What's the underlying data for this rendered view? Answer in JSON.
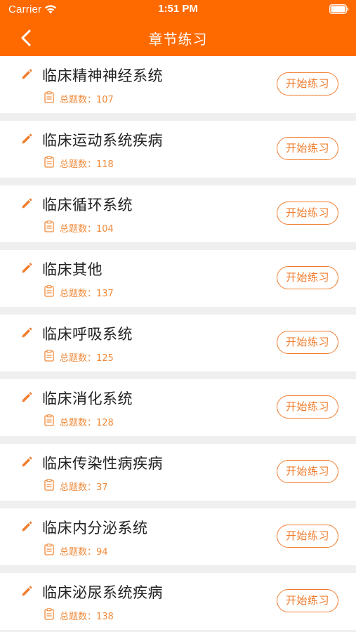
{
  "status_bar": {
    "carrier": "Carrier",
    "time": "1:51 PM"
  },
  "nav": {
    "title": "章节练习",
    "back_icon": "chevron-left-icon"
  },
  "colors": {
    "accent": "#ff6a00",
    "button": "#f07d2e",
    "background": "#efefef"
  },
  "chapters": [
    {
      "title": "临床精神神经系统",
      "count_text": "总题数：107",
      "button": "开始练习"
    },
    {
      "title": "临床运动系统疾病",
      "count_text": "总题数：118",
      "button": "开始练习"
    },
    {
      "title": "临床循环系统",
      "count_text": "总题数：104",
      "button": "开始练习"
    },
    {
      "title": "临床其他",
      "count_text": "总题数：137",
      "button": "开始练习"
    },
    {
      "title": "临床呼吸系统",
      "count_text": "总题数：125",
      "button": "开始练习"
    },
    {
      "title": "临床消化系统",
      "count_text": "总题数：128",
      "button": "开始练习"
    },
    {
      "title": "临床传染性病疾病",
      "count_text": "总题数：37",
      "button": "开始练习"
    },
    {
      "title": "临床内分泌系统",
      "count_text": "总题数：94",
      "button": "开始练习"
    },
    {
      "title": "临床泌尿系统疾病",
      "count_text": "总题数：138",
      "button": "开始练习"
    }
  ]
}
